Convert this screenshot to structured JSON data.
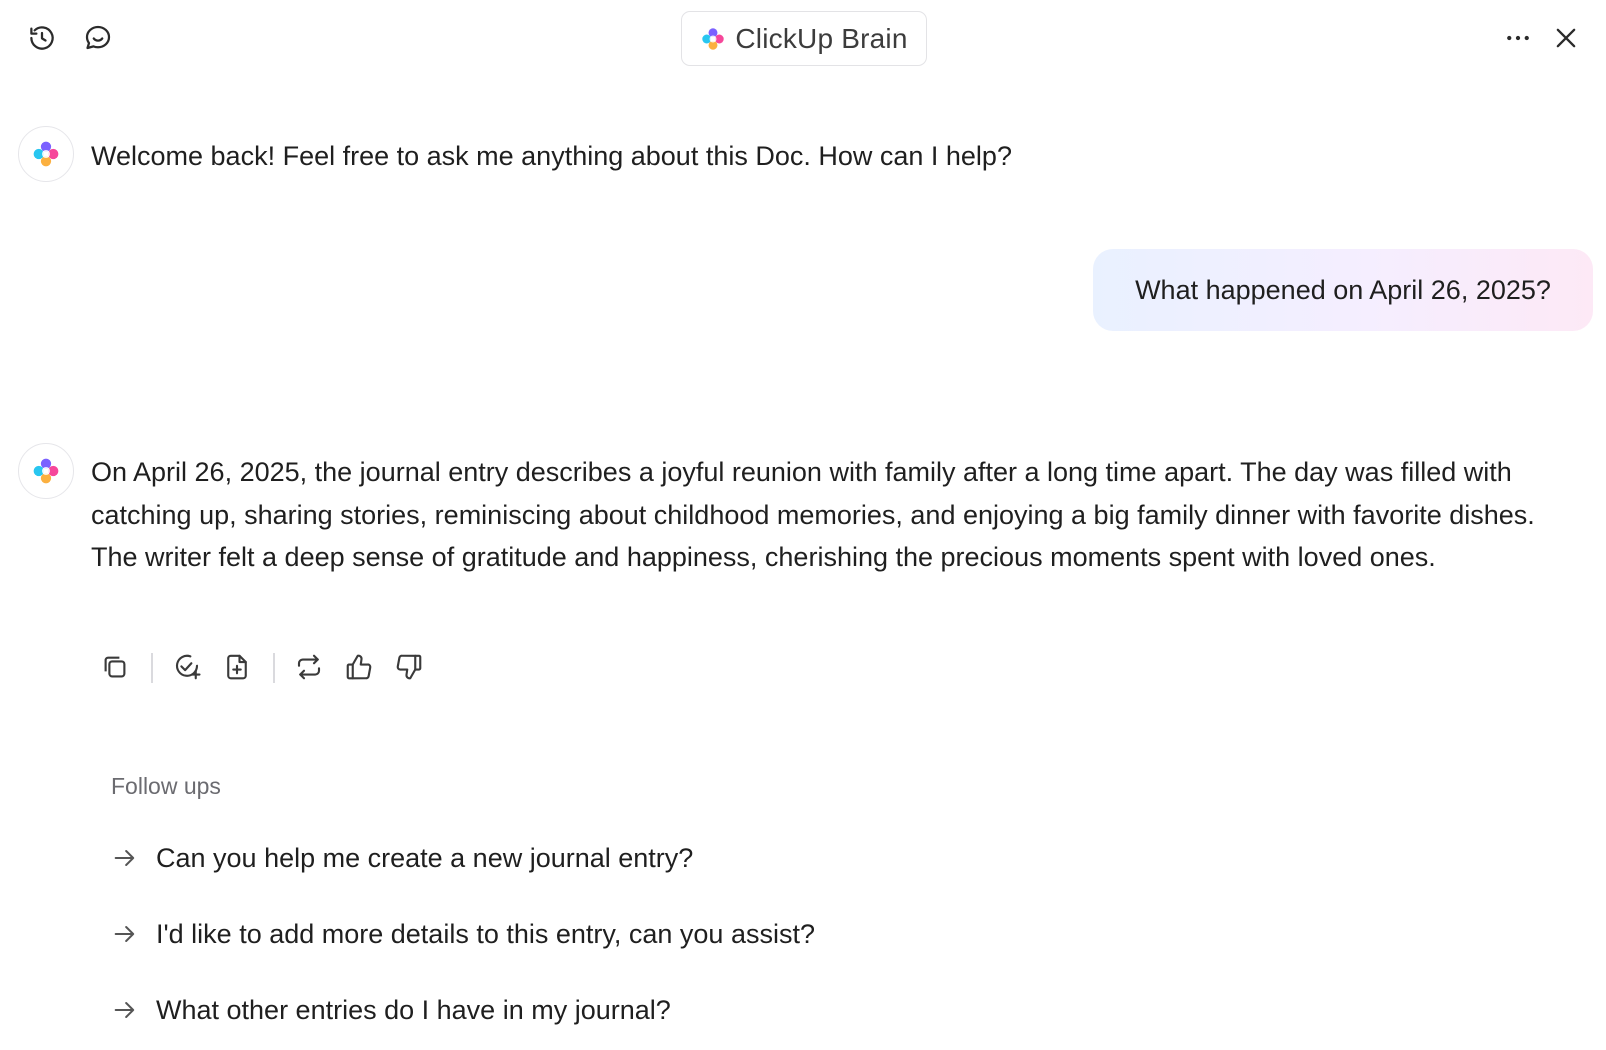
{
  "header": {
    "title": "ClickUp Brain",
    "history_icon": "history-icon",
    "new_chat_icon": "new-chat-icon",
    "more_icon": "more-horizontal-icon",
    "close_icon": "close-icon"
  },
  "brand_colors": [
    "#7b61ff",
    "#f6479a",
    "#28c6f0",
    "#fbb040"
  ],
  "conversation": {
    "welcome": "Welcome back! Feel free to ask me anything about this Doc. How can I help?",
    "user_question": "What happened on April 26, 2025?",
    "answer": "On April 26, 2025, the journal entry describes a joyful reunion with family after a long time apart. The day was filled with catching up, sharing stories, reminiscing about childhood memories, and enjoying a big family dinner with favorite dishes. The writer felt a deep sense of gratitude and happiness, cherishing the precious moments spent with loved ones."
  },
  "answer_actions": [
    {
      "icon": "copy-icon"
    },
    {
      "icon": "create-task-icon"
    },
    {
      "icon": "add-to-doc-icon"
    },
    {
      "icon": "regenerate-icon"
    },
    {
      "icon": "thumbs-up-icon"
    },
    {
      "icon": "thumbs-down-icon"
    }
  ],
  "followups": {
    "label": "Follow ups",
    "items": [
      "Can you help me create a new journal entry?",
      "I'd like to add more details to this entry, can you assist?",
      "What other entries do I have in my journal?"
    ]
  }
}
